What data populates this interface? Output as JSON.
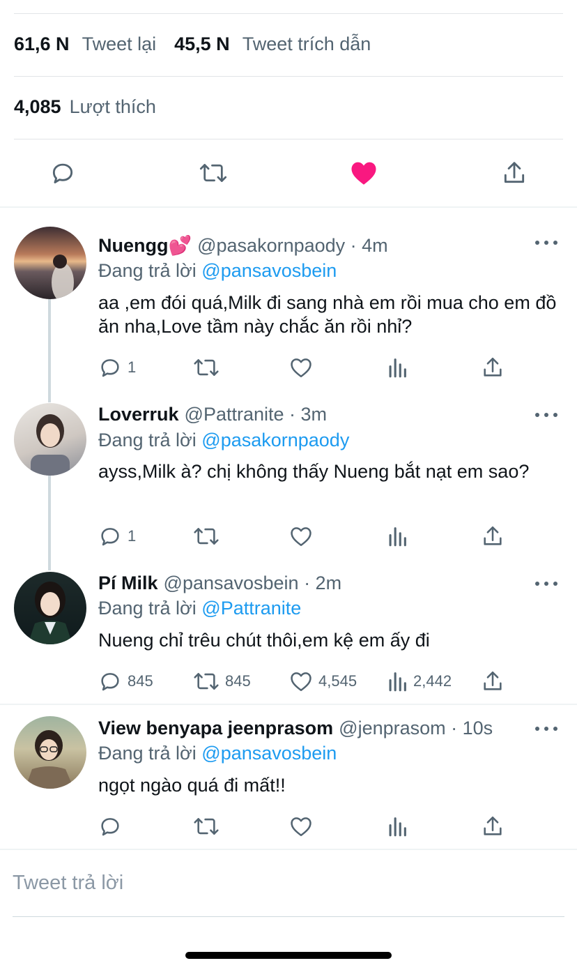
{
  "stats": {
    "retweets_num": "61,6 N",
    "retweets_label": "Tweet lại",
    "quotes_num": "45,5 N",
    "quotes_label": "Tweet trích dẫn",
    "likes_num": "4,085",
    "likes_label": "Lượt thích"
  },
  "main_actions": [
    "reply-icon",
    "retweet-icon",
    "heart-filled-icon",
    "share-icon"
  ],
  "colors": {
    "accent_blue": "#1d9bf0",
    "like_red": "#f91880",
    "text_primary": "#0f1419",
    "text_secondary": "#536471"
  },
  "replies": [
    {
      "name": "Nuengg💕",
      "handle": "@pasakornpaody · 4m",
      "replying_prefix": "Đang trả lời",
      "replying_to": "@pansavosbein",
      "text": "aa ,em đói quá,Milk đi sang nhà em rồi mua cho em đồ ăn nha,Love tầm này chắc ăn rồi nhỉ?",
      "reply_count": "1",
      "retweet_count": "",
      "like_count": "",
      "view_count": ""
    },
    {
      "name": "Loverruk",
      "handle": "@Pattranite · 3m",
      "replying_prefix": "Đang trả lời",
      "replying_to": "@pasakornpaody",
      "text": "ayss,Milk à? chị không thấy Nueng bắt nạt em sao?",
      "reply_count": "1",
      "retweet_count": "",
      "like_count": "",
      "view_count": ""
    },
    {
      "name": "Pí Milk",
      "handle": "@pansavosbein · 2m",
      "replying_prefix": "Đang trả lời",
      "replying_to": "@Pattranite",
      "text": "Nueng chỉ trêu chút thôi,em kệ em ấy đi",
      "reply_count": "845",
      "retweet_count": "845",
      "like_count": "4,545",
      "view_count": "2,442"
    },
    {
      "name": "View benyapa jeenprasom",
      "handle": "@jenprasom · 10s",
      "replying_prefix": "Đang trả lời",
      "replying_to": "@pansavosbein",
      "text": "ngọt ngào quá đi mất!!",
      "reply_count": "",
      "retweet_count": "",
      "like_count": "",
      "view_count": ""
    }
  ],
  "composer": {
    "placeholder": "Tweet trả lời"
  }
}
